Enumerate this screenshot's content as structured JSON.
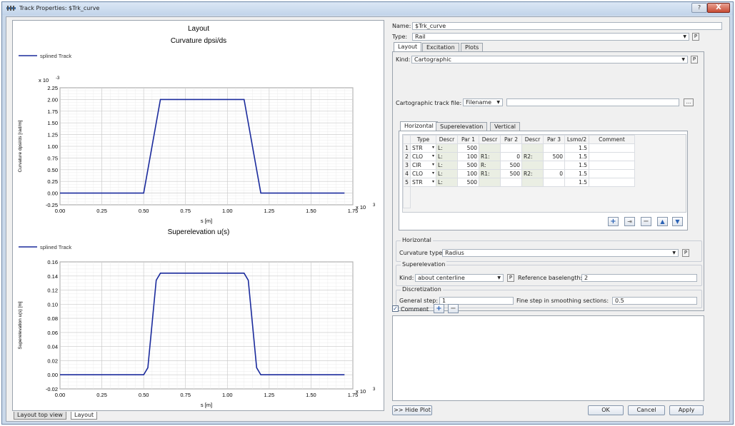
{
  "window": {
    "title": "Track Properties: $Trk_curve",
    "help_label": "?",
    "close_label": "X"
  },
  "plots": {
    "layout_title": "Layout",
    "tabs": [
      "Layout top view",
      "Layout"
    ]
  },
  "chart_data": [
    {
      "type": "line",
      "title": "Curvature dpsi/ds",
      "legend": "splined Track",
      "xlabel": "s [m]",
      "ylabel": "Curvature dpsi/ds [rad/m]",
      "x_multiplier": "x 10",
      "x_multiplier_exp": "3",
      "y_multiplier": "x 10",
      "y_multiplier_exp": "-3",
      "xlim": [
        0,
        1.75
      ],
      "ylim": [
        -0.25,
        2.25
      ],
      "x_ticks": [
        "0.00",
        "0.25",
        "0.50",
        "0.75",
        "1.00",
        "1.25",
        "1.50",
        "1.75"
      ],
      "y_ticks": [
        "-0.25",
        "0.00",
        "0.25",
        "0.50",
        "0.75",
        "1.00",
        "1.25",
        "1.50",
        "1.75",
        "2.00",
        "2.25"
      ],
      "grid": true,
      "series": [
        {
          "name": "splined Track",
          "color": "#1a2a9c",
          "x": [
            0,
            0.5,
            0.6,
            1.1,
            1.2,
            1.7
          ],
          "y": [
            0,
            0,
            2.0,
            2.0,
            0,
            0
          ]
        }
      ]
    },
    {
      "type": "line",
      "title": "Superelevation u(s)",
      "legend": "splined Track",
      "xlabel": "s [m]",
      "ylabel": "Superelevation u(s) [m]",
      "x_multiplier": "x 10",
      "x_multiplier_exp": "3",
      "xlim": [
        0,
        1.75
      ],
      "ylim": [
        -0.02,
        0.16
      ],
      "x_ticks": [
        "0.00",
        "0.25",
        "0.50",
        "0.75",
        "1.00",
        "1.25",
        "1.50",
        "1.75"
      ],
      "y_ticks": [
        "-0.02",
        "0.00",
        "0.02",
        "0.04",
        "0.06",
        "0.08",
        "0.10",
        "0.12",
        "0.14",
        "0.16"
      ],
      "grid": true,
      "series": [
        {
          "name": "splined Track",
          "color": "#1a2a9c",
          "x": [
            0,
            0.5,
            0.525,
            0.55,
            0.575,
            0.6,
            1.1,
            1.125,
            1.15,
            1.175,
            1.2,
            1.7
          ],
          "y": [
            0,
            0,
            0.01,
            0.072,
            0.134,
            0.144,
            0.144,
            0.134,
            0.072,
            0.01,
            0,
            0
          ]
        }
      ]
    }
  ],
  "props": {
    "name_label": "Name:",
    "name_value": "$Trk_curve",
    "type_label": "Type:",
    "type_value": "Rail",
    "p_label": "P",
    "tabs": [
      "Layout",
      "Excitation",
      "Plots"
    ],
    "kind_label": "Kind:",
    "kind_value": "Cartographic",
    "carto_label": "Cartographic track file:",
    "carto_mode": "Filename",
    "carto_value": "",
    "browse_label": "...",
    "subtabs": [
      "Horizontal",
      "Superelevation",
      "Vertical"
    ],
    "table": {
      "headers": [
        "Type",
        "Descr",
        "Par 1",
        "Descr",
        "Par 2",
        "Descr",
        "Par 3",
        "Lsmo/2",
        "Comment"
      ],
      "rows": [
        {
          "n": "1",
          "type": "STR",
          "d1": "L:",
          "p1": "500",
          "d2": "",
          "p2": "",
          "d3": "",
          "p3": "",
          "lsmo": "1.5",
          "comment": ""
        },
        {
          "n": "2",
          "type": "CLO",
          "d1": "L:",
          "p1": "100",
          "d2": "R1:",
          "p2": "0",
          "d3": "R2:",
          "p3": "500",
          "lsmo": "1.5",
          "comment": ""
        },
        {
          "n": "3",
          "type": "CIR",
          "d1": "L:",
          "p1": "500",
          "d2": "R:",
          "p2": "500",
          "d3": "",
          "p3": "",
          "lsmo": "1.5",
          "comment": ""
        },
        {
          "n": "4",
          "type": "CLO",
          "d1": "L:",
          "p1": "100",
          "d2": "R1:",
          "p2": "500",
          "d3": "R2:",
          "p3": "0",
          "lsmo": "1.5",
          "comment": ""
        },
        {
          "n": "5",
          "type": "STR",
          "d1": "L:",
          "p1": "500",
          "d2": "",
          "p2": "",
          "d3": "",
          "p3": "",
          "lsmo": "1.5",
          "comment": ""
        }
      ]
    },
    "horizontal_group": "Horizontal",
    "curv_label": "Curvature type:",
    "curv_value": "Radius",
    "super_group": "Superelevation",
    "super_kind_label": "Kind:",
    "super_kind_value": "about centerline",
    "ref_label": "Reference baselength:",
    "ref_value": "2",
    "disc_group": "Discretization",
    "gen_label": "General step:",
    "gen_value": "1",
    "fine_label": "Fine step in smoothing sections:",
    "fine_value": "0.5",
    "comment_label": "Comment",
    "hide_plot": ">> Hide Plot",
    "ok": "OK",
    "cancel": "Cancel",
    "apply": "Apply"
  }
}
